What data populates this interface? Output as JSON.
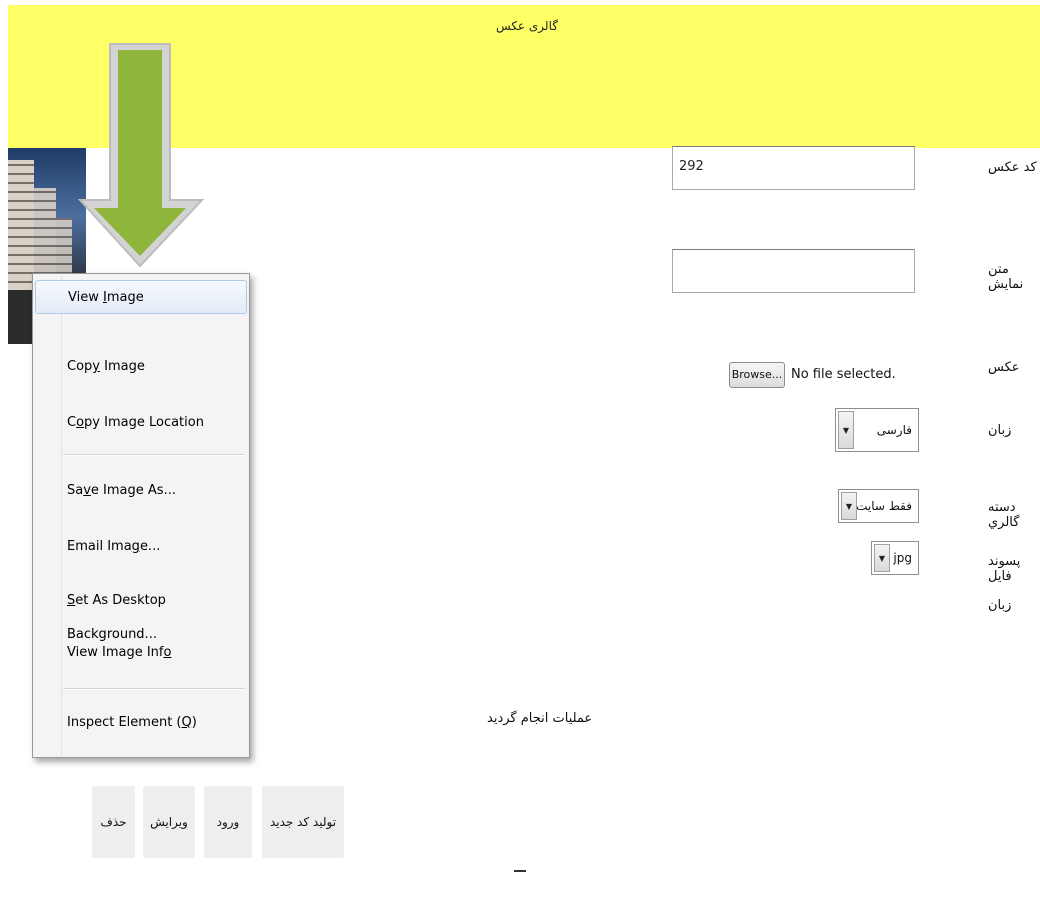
{
  "banner": {
    "title": "گالری عکس",
    "color": "#ffff66"
  },
  "form": {
    "code_label": "کد عکس",
    "code_value": "292",
    "display_text_label": "متن نمایش",
    "display_text_value": "",
    "image_label": "عکس",
    "browse_label": "Browse...",
    "no_file_text": "No file selected.",
    "language_label": "زبان",
    "language_value": "فارسی",
    "gallery_category_label": "دسته گالري",
    "gallery_category_value": "فقط سایت",
    "file_ext_label": "پسوند فایل",
    "file_ext_value": "jpg",
    "language_label_2": "زبان"
  },
  "status_message": "عملیات انجام گردید",
  "actions": {
    "generate_code": "تولید کد جدید",
    "enter": "ورود",
    "edit": "ویرایش",
    "delete": "حذف"
  },
  "footer_text": "—",
  "context_menu": {
    "items": [
      {
        "pre": "View ",
        "mnemonic": "I",
        "post": "mage"
      },
      {
        "pre": "Cop",
        "mnemonic": "y",
        "post": " Image"
      },
      {
        "pre": "C",
        "mnemonic": "o",
        "post": "py Image Location"
      },
      {
        "pre": "Sa",
        "mnemonic": "v",
        "post": "e Image As..."
      },
      {
        "pre": "Email Ima",
        "mnemonic": "g",
        "post": "e..."
      },
      {
        "pre": "",
        "mnemonic": "S",
        "post": "et As Desktop Background..."
      },
      {
        "pre": "View Image Inf",
        "mnemonic": "o",
        "post": ""
      },
      {
        "pre": "Inspect Element (",
        "mnemonic": "Q",
        "post": ")"
      }
    ],
    "highlighted_index": 0
  },
  "overlay": {
    "arrow_icon": "down-arrow-icon",
    "arrow_color": "#8fb63a",
    "arrow_border": "#c8c8c8"
  }
}
